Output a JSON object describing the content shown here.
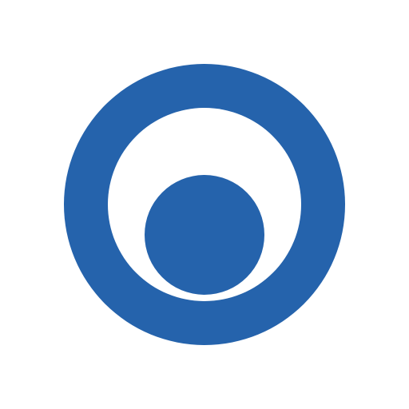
{
  "logo": {
    "name": "ring-with-inner-dot-logo",
    "colors": {
      "brand_blue": "#2563AC",
      "inner_white": "#FFFFFF",
      "background": "#FFFFFF"
    }
  }
}
